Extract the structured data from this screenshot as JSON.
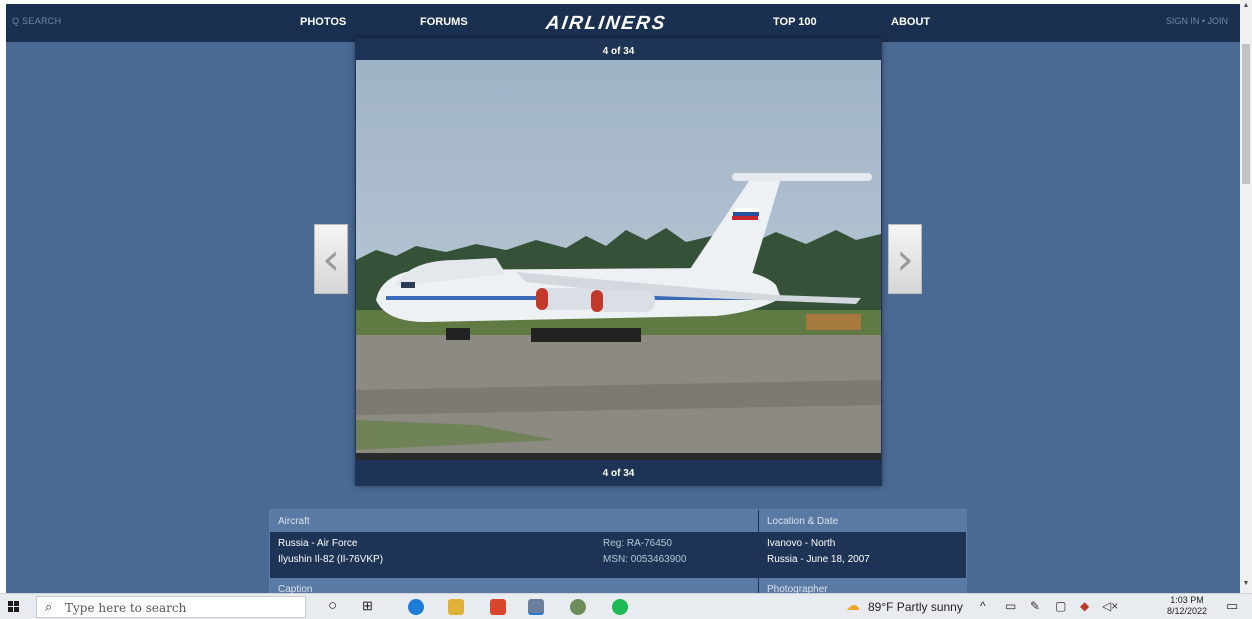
{
  "nav": {
    "search_label": "Q SEARCH",
    "photos": "PHOTOS",
    "forums": "FORUMS",
    "logo": "AIRLINERS",
    "top100": "TOP 100",
    "about": "ABOUT",
    "signin": "SIGN IN • JOIN"
  },
  "viewer": {
    "counter_top": "4 of 34",
    "counter_bottom": "4 of 34"
  },
  "info": {
    "headers": {
      "aircraft": "Aircraft",
      "location": "Location & Date",
      "caption": "Caption",
      "photographer": "Photographer"
    },
    "airline": "Russia - Air Force",
    "aircraft_type": "Ilyushin Il-82 (Il-76VKP)",
    "reg": "Reg: RA-76450",
    "msn": "MSN: 0053463900",
    "location": "Ivanovo - North",
    "date": "Russia - June 18, 2007"
  },
  "taskbar": {
    "search_placeholder": "Type here to search",
    "weather": "89°F  Partly sunny",
    "time": "1:03 PM",
    "date": "8/12/2022"
  },
  "colors": {
    "page_bg": "#4a6a94",
    "nav_bg": "#1a3050",
    "panel_bg": "#1e3456",
    "header_bg": "#5b7aa3"
  }
}
